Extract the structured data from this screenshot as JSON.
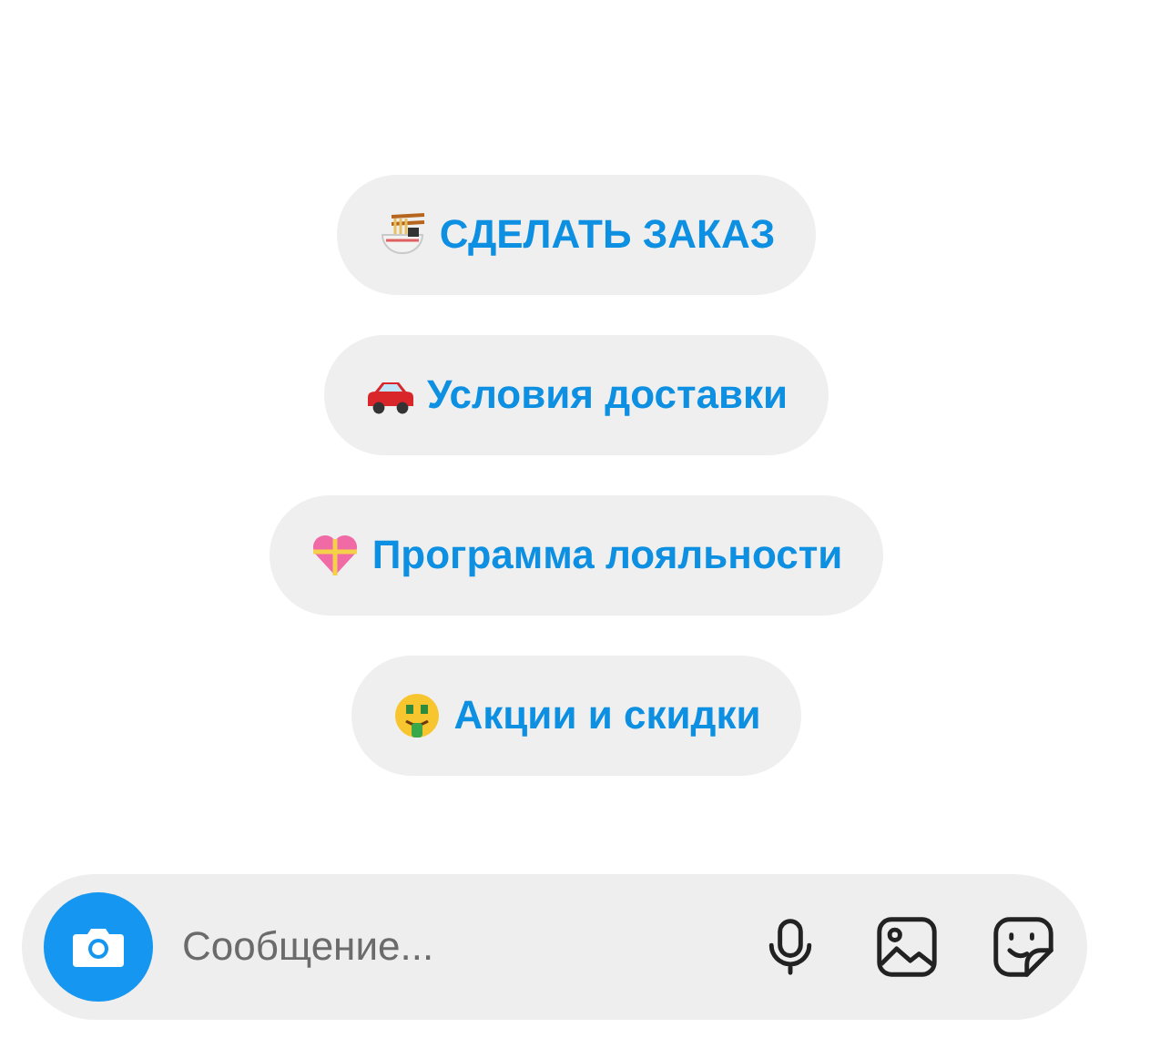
{
  "quick_replies": [
    {
      "label": "СДЕЛАТЬ ЗАКАЗ"
    },
    {
      "label": "Условия доставки"
    },
    {
      "label": "Программа лояльности"
    },
    {
      "label": "Акции и скидки"
    }
  ],
  "composer": {
    "placeholder": "Сообщение..."
  }
}
